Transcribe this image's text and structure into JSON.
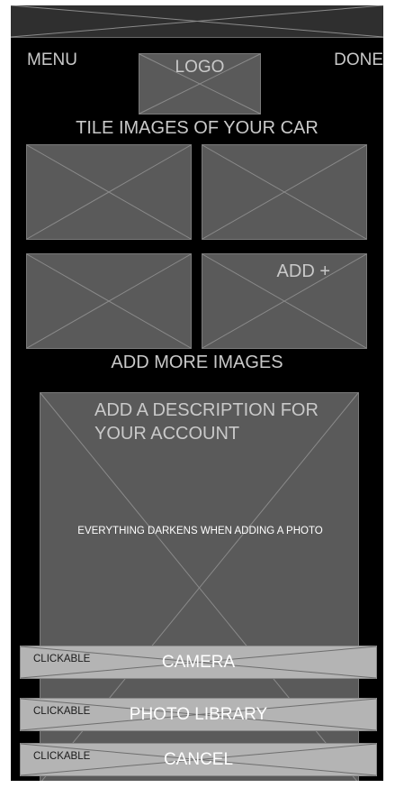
{
  "nav": {
    "menu_label": "MENU",
    "logo_label": "LOGO",
    "done_label": "DONE"
  },
  "gallery": {
    "heading": "TILE IMAGES OF YOUR CAR",
    "add_tile_label": "ADD +",
    "add_more_label": "ADD MORE IMAGES"
  },
  "description": {
    "prompt": "ADD A DESCRIPTION FOR YOUR ACCOUNT",
    "overlay_note": "EVERYTHING DARKENS WHEN ADDING A PHOTO"
  },
  "action_sheet": {
    "buttons": [
      {
        "tag": "CLICKABLE",
        "label": "CAMERA"
      },
      {
        "tag": "CLICKABLE",
        "label": "PHOTO LIBRARY"
      },
      {
        "tag": "CLICKABLE",
        "label": "CANCEL"
      }
    ]
  },
  "colors": {
    "background": "#000000",
    "placeholder": "#5a5a5a",
    "placeholder_cross": "#8a8a8a",
    "label_text": "#c9c9c9",
    "sheet_button": "#b4b4b4"
  }
}
